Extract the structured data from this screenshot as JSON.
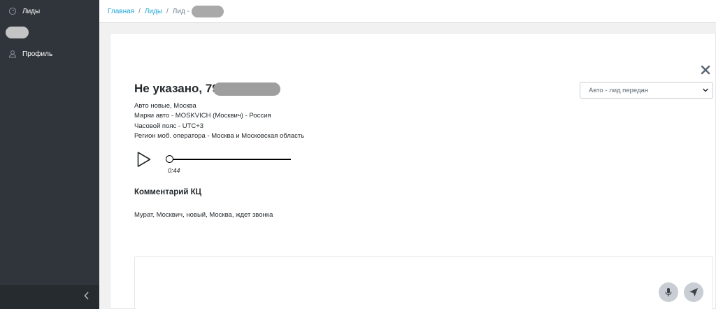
{
  "sidebar": {
    "items": [
      {
        "label": "Лиды",
        "icon": "gauge-icon"
      },
      {
        "label": "Профиль",
        "icon": "user-icon"
      }
    ],
    "toggle_icon": "chevron-left-icon"
  },
  "breadcrumb": {
    "home": "Главная",
    "leads": "Лиды",
    "current": "Лид -",
    "separator": "/"
  },
  "lead": {
    "title": "Не указано, 79",
    "status_selected": "Авто - лид передан",
    "info": [
      "Авто новые, Москва",
      "Марки авто - MOSKVICH (Москвич) - Россия",
      "Часовой пояс - UTC+3",
      "Регион моб. оператора - Москва и Московская область"
    ]
  },
  "player": {
    "time": "0:44",
    "progress": 0
  },
  "comment": {
    "heading": "Комментарий КЦ",
    "text": "Мурат, Москвич, новый, Москва, ждет звонка"
  },
  "colors": {
    "sidebar_bg": "#2f353a",
    "link": "#20a8d8",
    "round_button": "#c8ced3"
  }
}
